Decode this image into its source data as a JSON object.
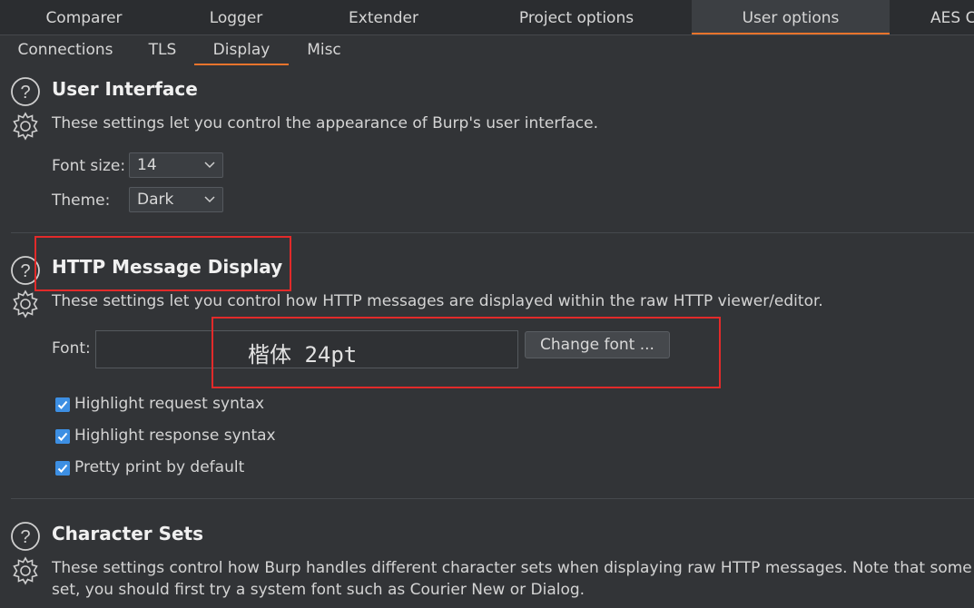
{
  "top_tabs": [
    "Comparer",
    "Logger",
    "Extender",
    "Project options",
    "User options",
    "AES C"
  ],
  "sub_tabs": [
    "Connections",
    "TLS",
    "Display",
    "Misc"
  ],
  "ui_section": {
    "title": "User Interface",
    "description": "These settings let you control the appearance of Burp's user interface.",
    "font_size_label": "Font size:",
    "font_size_value": "14",
    "theme_label": "Theme:",
    "theme_value": "Dark"
  },
  "http_section": {
    "title": "HTTP Message Display",
    "description": "These settings let you control how HTTP messages are displayed within the raw HTTP viewer/editor.",
    "font_label": "Font:",
    "font_value": "楷体 24pt",
    "change_font_button": "Change font ...",
    "checkboxes": [
      {
        "label": "Highlight request syntax",
        "checked": true
      },
      {
        "label": "Highlight response syntax",
        "checked": true
      },
      {
        "label": "Pretty print by default",
        "checked": true
      }
    ]
  },
  "charset_section": {
    "title": "Character Sets",
    "description_line1": "These settings control how Burp handles different character sets when displaying raw HTTP messages. Note that some",
    "description_line2": "set, you should first try a system font such as Courier New or Dialog."
  },
  "colors": {
    "accent": "#e8742c",
    "checkbox": "#3d8fe3",
    "annotation": "#e22a2a"
  }
}
